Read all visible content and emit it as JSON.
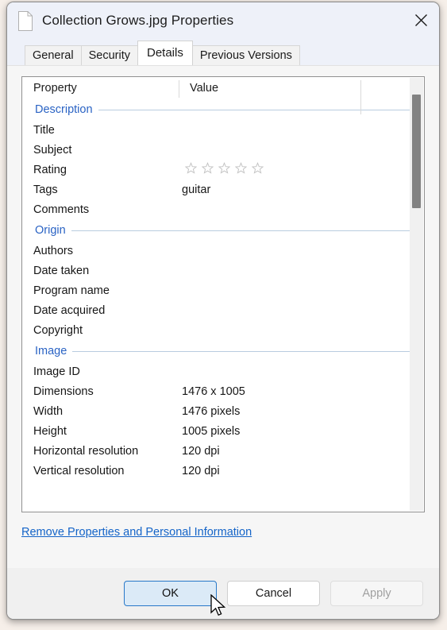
{
  "window": {
    "title": "Collection Grows.jpg Properties",
    "icon": "document-icon",
    "close_label": "×"
  },
  "tabs": [
    {
      "label": "General",
      "active": false
    },
    {
      "label": "Security",
      "active": false
    },
    {
      "label": "Details",
      "active": true
    },
    {
      "label": "Previous Versions",
      "active": false
    }
  ],
  "grid": {
    "columns": [
      "Property",
      "Value"
    ],
    "groups": [
      {
        "name": "Description",
        "rows": [
          {
            "property": "Title",
            "value": ""
          },
          {
            "property": "Subject",
            "value": ""
          },
          {
            "property": "Rating",
            "value": "",
            "type": "stars",
            "stars_total": 5,
            "stars_filled": 0
          },
          {
            "property": "Tags",
            "value": "guitar"
          },
          {
            "property": "Comments",
            "value": ""
          }
        ]
      },
      {
        "name": "Origin",
        "rows": [
          {
            "property": "Authors",
            "value": ""
          },
          {
            "property": "Date taken",
            "value": ""
          },
          {
            "property": "Program name",
            "value": ""
          },
          {
            "property": "Date acquired",
            "value": ""
          },
          {
            "property": "Copyright",
            "value": ""
          }
        ]
      },
      {
        "name": "Image",
        "rows": [
          {
            "property": "Image ID",
            "value": ""
          },
          {
            "property": "Dimensions",
            "value": "1476 x 1005"
          },
          {
            "property": "Width",
            "value": "1476 pixels"
          },
          {
            "property": "Height",
            "value": "1005 pixels"
          },
          {
            "property": "Horizontal resolution",
            "value": "120 dpi"
          },
          {
            "property": "Vertical resolution",
            "value": "120 dpi"
          }
        ]
      }
    ]
  },
  "link": {
    "remove_label": "Remove Properties and Personal Information"
  },
  "buttons": {
    "ok": "OK",
    "cancel": "Cancel",
    "apply": "Apply"
  },
  "colors": {
    "accent_group_header": "#2a63c4",
    "link": "#1464c8",
    "titlebar": "#eef1f9",
    "hover_button_border": "#2878c8",
    "hover_button_fill": "#dbeaf7"
  }
}
